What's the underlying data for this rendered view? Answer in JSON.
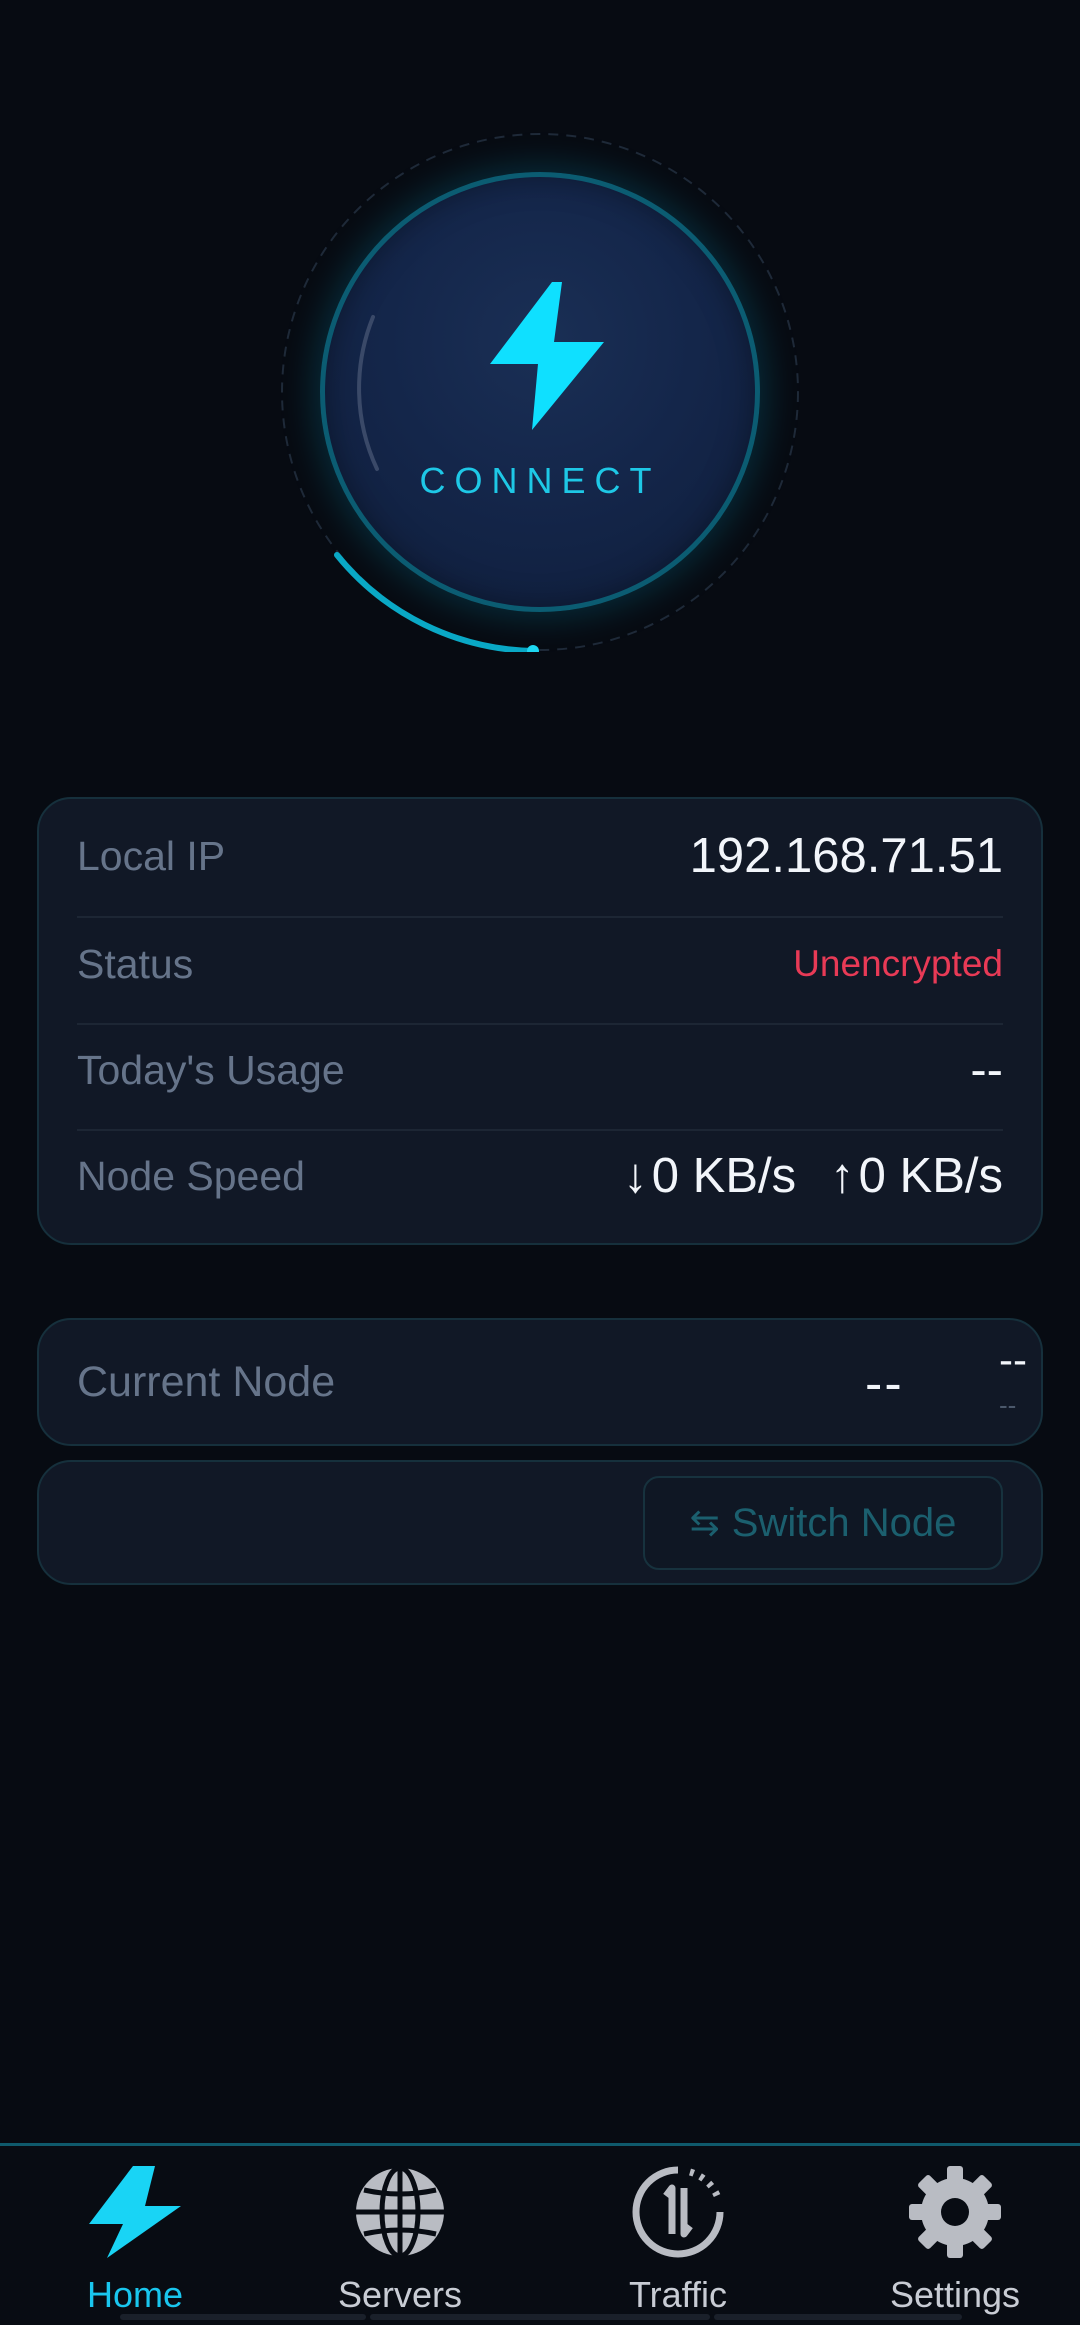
{
  "connect": {
    "label": "CONNECT",
    "accent_color": "#1ec8e6",
    "icon": "lightning-bolt-icon"
  },
  "info": {
    "local_ip": {
      "label": "Local IP",
      "value": "192.168.71.51"
    },
    "status": {
      "label": "Status",
      "value": "Unencrypted",
      "color": "#e83a56"
    },
    "usage": {
      "label": "Today's Usage",
      "value": "--"
    },
    "speed": {
      "label": "Node Speed",
      "down_arrow": "↓",
      "down_value": "0 KB/s",
      "up_arrow": "↑",
      "up_value": "0 KB/s"
    }
  },
  "node": {
    "label": "Current Node",
    "flag": "--",
    "name": "--",
    "sub": "--"
  },
  "switch_node": {
    "icon": "⇆",
    "label": "Switch Node"
  },
  "nav": {
    "items": [
      {
        "label": "Home",
        "icon": "lightning-bolt-icon",
        "active": true
      },
      {
        "label": "Servers",
        "icon": "globe-icon",
        "active": false
      },
      {
        "label": "Traffic",
        "icon": "traffic-icon",
        "active": false
      },
      {
        "label": "Settings",
        "icon": "gear-icon",
        "active": false
      }
    ]
  }
}
